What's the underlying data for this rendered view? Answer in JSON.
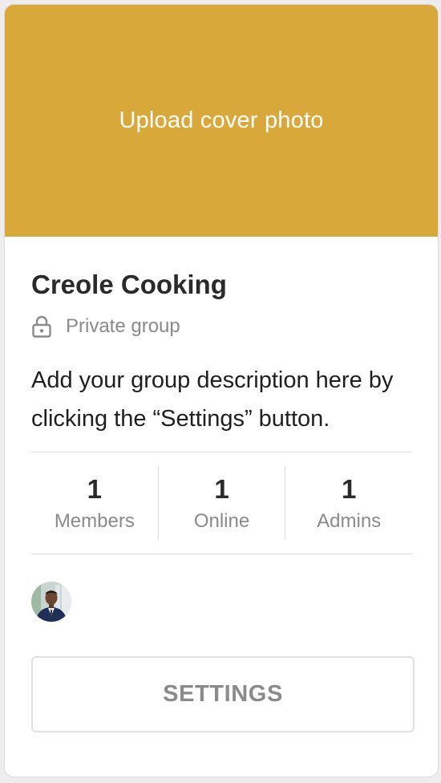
{
  "cover": {
    "label": "Upload cover photo",
    "color": "#d9a83b"
  },
  "group": {
    "name": "Creole Cooking",
    "privacy_icon": "lock-icon",
    "privacy_label": "Private group",
    "description": "Add your group description here by clicking the “Settings” button."
  },
  "stats": [
    {
      "value": "1",
      "label": "Members"
    },
    {
      "value": "1",
      "label": "Online"
    },
    {
      "value": "1",
      "label": "Admins"
    }
  ],
  "members": {
    "avatar_icon": "member-avatar"
  },
  "settings": {
    "label": "SETTINGS"
  }
}
